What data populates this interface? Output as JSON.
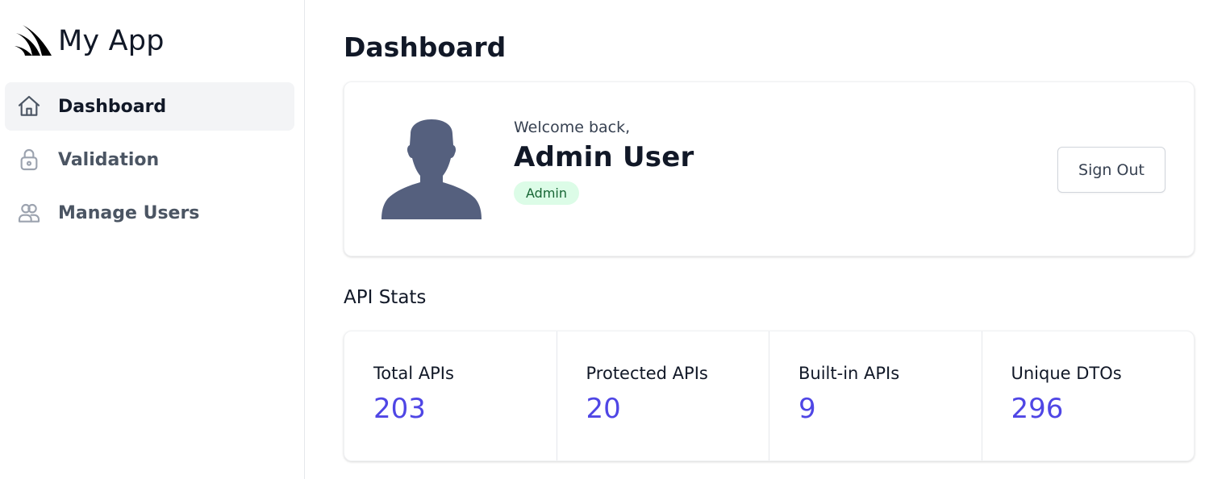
{
  "app": {
    "name": "My App"
  },
  "sidebar": {
    "items": [
      {
        "label": "Dashboard",
        "icon": "home-icon",
        "active": true
      },
      {
        "label": "Validation",
        "icon": "lock-icon",
        "active": false
      },
      {
        "label": "Manage Users",
        "icon": "users-icon",
        "active": false
      }
    ]
  },
  "main": {
    "title": "Dashboard",
    "profile": {
      "welcome": "Welcome back,",
      "name": "Admin User",
      "role": "Admin",
      "sign_out_label": "Sign Out",
      "avatar_icon": "user-silhouette-icon"
    },
    "stats_title": "API Stats",
    "stats": [
      {
        "label": "Total APIs",
        "value": "203"
      },
      {
        "label": "Protected APIs",
        "value": "20"
      },
      {
        "label": "Built-in APIs",
        "value": "9"
      },
      {
        "label": "Unique DTOs",
        "value": "296"
      }
    ]
  },
  "colors": {
    "accent": "#4f46e5",
    "badge_bg": "#dcfce7",
    "badge_text": "#166534",
    "avatar": "#55607e",
    "active_nav_bg": "#f3f4f6"
  }
}
